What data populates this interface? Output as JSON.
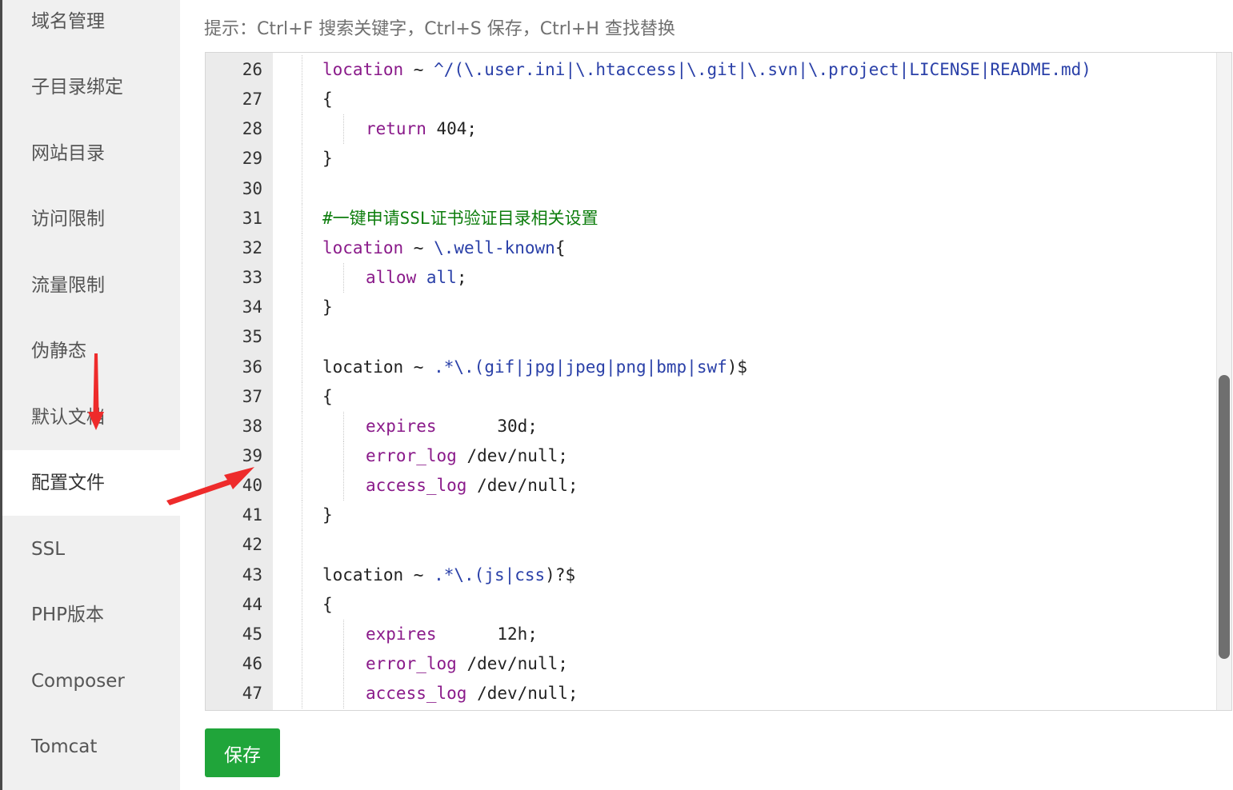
{
  "sidebar": {
    "items": [
      {
        "label": "域名管理"
      },
      {
        "label": "子目录绑定"
      },
      {
        "label": "网站目录"
      },
      {
        "label": "访问限制"
      },
      {
        "label": "流量限制"
      },
      {
        "label": "伪静态"
      },
      {
        "label": "默认文档"
      },
      {
        "label": "配置文件",
        "active": true
      },
      {
        "label": "SSL"
      },
      {
        "label": "PHP版本"
      },
      {
        "label": "Composer"
      },
      {
        "label": "Tomcat"
      }
    ]
  },
  "hint": "提示：Ctrl+F 搜索关键字，Ctrl+S 保存，Ctrl+H 查找替换",
  "editor": {
    "lines": [
      {
        "n": "26",
        "depth": 1,
        "segs": [
          [
            "location",
            "kw"
          ],
          [
            " ~ ",
            ""
          ],
          [
            "^/(\\.user.ini|\\.htaccess|\\.git|\\.svn|\\.project|LICENSE|README.md)",
            "rx"
          ]
        ]
      },
      {
        "n": "27",
        "depth": 1,
        "segs": [
          [
            "{",
            ""
          ]
        ]
      },
      {
        "n": "28",
        "depth": 2,
        "segs": [
          [
            "return",
            "kw"
          ],
          [
            " 404;",
            ""
          ]
        ]
      },
      {
        "n": "29",
        "depth": 1,
        "segs": [
          [
            "}",
            ""
          ]
        ]
      },
      {
        "n": "30",
        "depth": 1,
        "segs": []
      },
      {
        "n": "31",
        "depth": 1,
        "segs": [
          [
            "#一键申请SSL证书验证目录相关设置",
            "cm"
          ]
        ]
      },
      {
        "n": "32",
        "depth": 1,
        "segs": [
          [
            "location",
            "kw"
          ],
          [
            " ~ ",
            ""
          ],
          [
            "\\.well-known",
            "rx"
          ],
          [
            "{",
            ""
          ]
        ]
      },
      {
        "n": "33",
        "depth": 2,
        "segs": [
          [
            "allow",
            "kw"
          ],
          [
            " ",
            ""
          ],
          [
            "all",
            "rx"
          ],
          [
            ";",
            ""
          ]
        ]
      },
      {
        "n": "34",
        "depth": 1,
        "segs": [
          [
            "}",
            ""
          ]
        ]
      },
      {
        "n": "35",
        "depth": 1,
        "segs": []
      },
      {
        "n": "36",
        "depth": 1,
        "segs": [
          [
            "location",
            ""
          ],
          [
            " ~ ",
            ""
          ],
          [
            ".*\\.(",
            "rx"
          ],
          [
            "gif|jpg|jpeg|png|bmp|swf",
            "rx"
          ],
          [
            ")$",
            ""
          ]
        ]
      },
      {
        "n": "37",
        "depth": 1,
        "segs": [
          [
            "{",
            ""
          ]
        ]
      },
      {
        "n": "38",
        "depth": 2,
        "segs": [
          [
            "expires",
            "kw"
          ],
          [
            "      30d;",
            ""
          ]
        ]
      },
      {
        "n": "39",
        "depth": 2,
        "segs": [
          [
            "error_log",
            "kw"
          ],
          [
            " /dev/null;",
            ""
          ]
        ]
      },
      {
        "n": "40",
        "depth": 2,
        "segs": [
          [
            "access_log",
            "kw"
          ],
          [
            " /dev/null;",
            ""
          ]
        ]
      },
      {
        "n": "41",
        "depth": 1,
        "segs": [
          [
            "}",
            ""
          ]
        ]
      },
      {
        "n": "42",
        "depth": 1,
        "segs": []
      },
      {
        "n": "43",
        "depth": 1,
        "segs": [
          [
            "location",
            ""
          ],
          [
            " ~ ",
            ""
          ],
          [
            ".*\\.(",
            "rx"
          ],
          [
            "js|css",
            "rx"
          ],
          [
            ")?$",
            ""
          ]
        ]
      },
      {
        "n": "44",
        "depth": 1,
        "segs": [
          [
            "{",
            ""
          ]
        ]
      },
      {
        "n": "45",
        "depth": 2,
        "segs": [
          [
            "expires",
            "kw"
          ],
          [
            "      12h;",
            ""
          ]
        ]
      },
      {
        "n": "46",
        "depth": 2,
        "segs": [
          [
            "error_log",
            "kw"
          ],
          [
            " /dev/null;",
            ""
          ]
        ]
      },
      {
        "n": "47",
        "depth": 2,
        "segs": [
          [
            "access_log",
            "kw"
          ],
          [
            " /dev/null;",
            ""
          ]
        ]
      }
    ]
  },
  "save_label": "保存",
  "colors": {
    "save_button": "#20a53a",
    "annotation_arrow": "#ee2b2b"
  }
}
